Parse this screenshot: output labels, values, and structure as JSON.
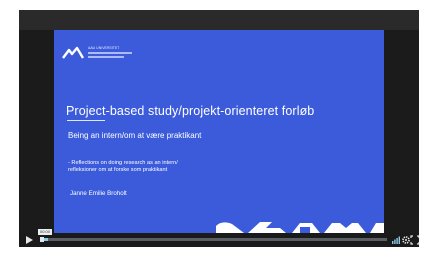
{
  "slide": {
    "title": "Project-based study/projekt-orienteret forløb",
    "subtitle": "Being an intern/om at være praktikant",
    "reflection_line1": "- Reflections on doing research as an intern/",
    "reflection_line2": "refleksioner om at forske som praktikant",
    "author": "Janne Emilie Broholt",
    "logo_line1": "AAU UNIVERSITET"
  },
  "player": {
    "time": "00:00",
    "progress": 0.02,
    "icons": {
      "play": "play-icon",
      "volume": "volume-icon",
      "settings": "gear-icon",
      "fullscreen": "fullscreen-icon"
    }
  },
  "colors": {
    "slide_background": "#3b5bdb",
    "progress_fill": "#8ecae6",
    "player_background": "#1f1f1f"
  }
}
